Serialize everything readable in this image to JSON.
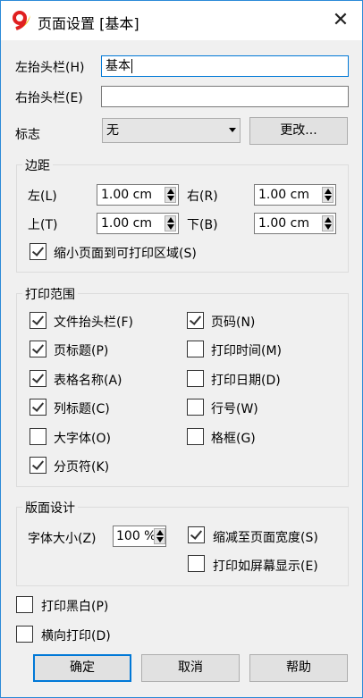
{
  "window": {
    "title": "页面设置 [基本]"
  },
  "header": {
    "left_label": "左抬头栏(H)",
    "left_value": "基本",
    "right_label": "右抬头栏(E)",
    "right_value": "",
    "logo_label": "标志",
    "logo_value": "无",
    "change_button": "更改..."
  },
  "margins": {
    "title": "边距",
    "left_label": "左(L)",
    "left_value": "1.00 cm",
    "right_label": "右(R)",
    "right_value": "1.00 cm",
    "top_label": "上(T)",
    "top_value": "1.00 cm",
    "bottom_label": "下(B)",
    "bottom_value": "1.00 cm",
    "shrink_label": "缩小页面到可打印区域(S)",
    "shrink_checked": true
  },
  "print_range": {
    "title": "打印范围",
    "items": [
      {
        "label": "文件抬头栏(F)",
        "checked": true
      },
      {
        "label": "页码(N)",
        "checked": true
      },
      {
        "label": "页标题(P)",
        "checked": true
      },
      {
        "label": "打印时间(M)",
        "checked": false
      },
      {
        "label": "表格名称(A)",
        "checked": true
      },
      {
        "label": "打印日期(D)",
        "checked": false
      },
      {
        "label": "列标题(C)",
        "checked": true
      },
      {
        "label": "行号(W)",
        "checked": false
      },
      {
        "label": "大字体(O)",
        "checked": false
      },
      {
        "label": "格框(G)",
        "checked": false
      },
      {
        "label": "分页符(K)",
        "checked": true
      }
    ]
  },
  "layout": {
    "title": "版面设计",
    "font_size_label": "字体大小(Z)",
    "font_size_value": "100 %",
    "fit_width_label": "缩减至页面宽度(S)",
    "fit_width_checked": true,
    "as_screen_label": "打印如屏幕显示(E)",
    "as_screen_checked": false
  },
  "options": {
    "bw_label": "打印黑白(P)",
    "bw_checked": false,
    "landscape_label": "横向打印(D)",
    "landscape_checked": false
  },
  "buttons": {
    "ok": "确定",
    "cancel": "取消",
    "help": "帮助"
  }
}
